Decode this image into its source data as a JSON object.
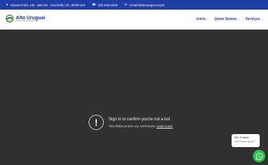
{
  "topbar": {
    "address": "Abramo Dorfo, 136 - sala 101 , Concórdia / SC, 89700-204",
    "phone": "(49) 3442-6333",
    "email": "contato@altouruguai.eng.br",
    "address_icon": "map-pin-icon",
    "phone_icon": "phone-icon",
    "email_icon": "envelope-icon"
  },
  "logo": {
    "name": "Alto Uruguai",
    "tagline": "Engenharia & Planejamento"
  },
  "nav": {
    "items": [
      {
        "label": "Início"
      },
      {
        "label": "Quem Somos"
      },
      {
        "label": "Serviços"
      }
    ]
  },
  "video_notice": {
    "icon": "!",
    "title": "Sign in to confirm you’re not a bot",
    "body": "This helps protect our community.",
    "link": "Learn more"
  },
  "whatsapp": {
    "name": "Alto Uruguai",
    "message": "Olá! Posso ajudar?",
    "icon": "whatsapp-icon"
  },
  "colors": {
    "topbar": "#1f3ea8",
    "video_bg": "#313131",
    "whatsapp": "#27c44b",
    "nav_text": "#2b3a8c"
  }
}
